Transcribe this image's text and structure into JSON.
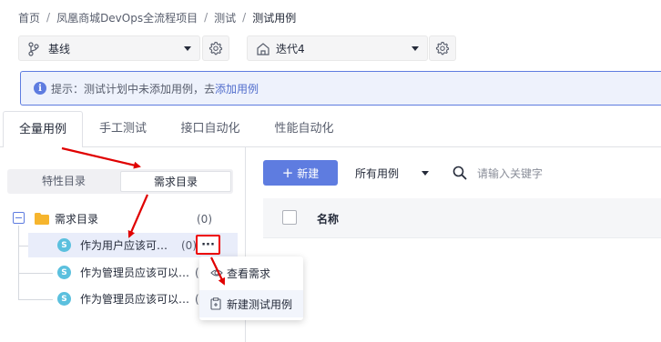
{
  "breadcrumb": {
    "items": [
      "首页",
      "凤凰商城DevOps全流程项目",
      "测试",
      "测试用例"
    ],
    "separator": "/"
  },
  "selectors": {
    "branch": {
      "icon": "branch-icon",
      "value": "基线"
    },
    "iteration": {
      "icon": "iteration-icon",
      "value": "迭代4"
    }
  },
  "info_bar": {
    "icon": "info-icon",
    "icon_glyph": "i",
    "text": "提示：测试计划中未添加用例，去",
    "link": "添加用例"
  },
  "tabs": [
    {
      "label": "全量用例",
      "active": true
    },
    {
      "label": "手工测试",
      "active": false
    },
    {
      "label": "接口自动化",
      "active": false
    },
    {
      "label": "性能自动化",
      "active": false
    }
  ],
  "segment": {
    "options": [
      {
        "label": "特性目录",
        "active": false
      },
      {
        "label": "需求目录",
        "active": true
      }
    ]
  },
  "tree": {
    "root": {
      "label": "需求目录",
      "count": "(0)"
    },
    "children": [
      {
        "badge": "S",
        "label": "作为用户应该可…",
        "count": "(0)",
        "selected": true
      },
      {
        "badge": "S",
        "label": "作为管理员应该可以…",
        "count": "(",
        "selected": false
      },
      {
        "badge": "S",
        "label": "作为管理员应该可以…",
        "count": "(",
        "selected": false
      }
    ],
    "more_button": "···"
  },
  "context_menu": {
    "items": [
      {
        "label": "查看需求",
        "icon": "eye-icon"
      },
      {
        "label": "新建测试用例",
        "icon": "add-case-icon"
      }
    ]
  },
  "toolbar": {
    "new_button": "新建",
    "new_plus": "+",
    "filter": "所有用例",
    "search_placeholder": "请输入关键字"
  },
  "table": {
    "columns": [
      "名称"
    ]
  },
  "colors": {
    "primary": "#5e7ce0",
    "annotation": "#e00000",
    "badge": "#5bc0de",
    "folder": "#f6b52e"
  }
}
